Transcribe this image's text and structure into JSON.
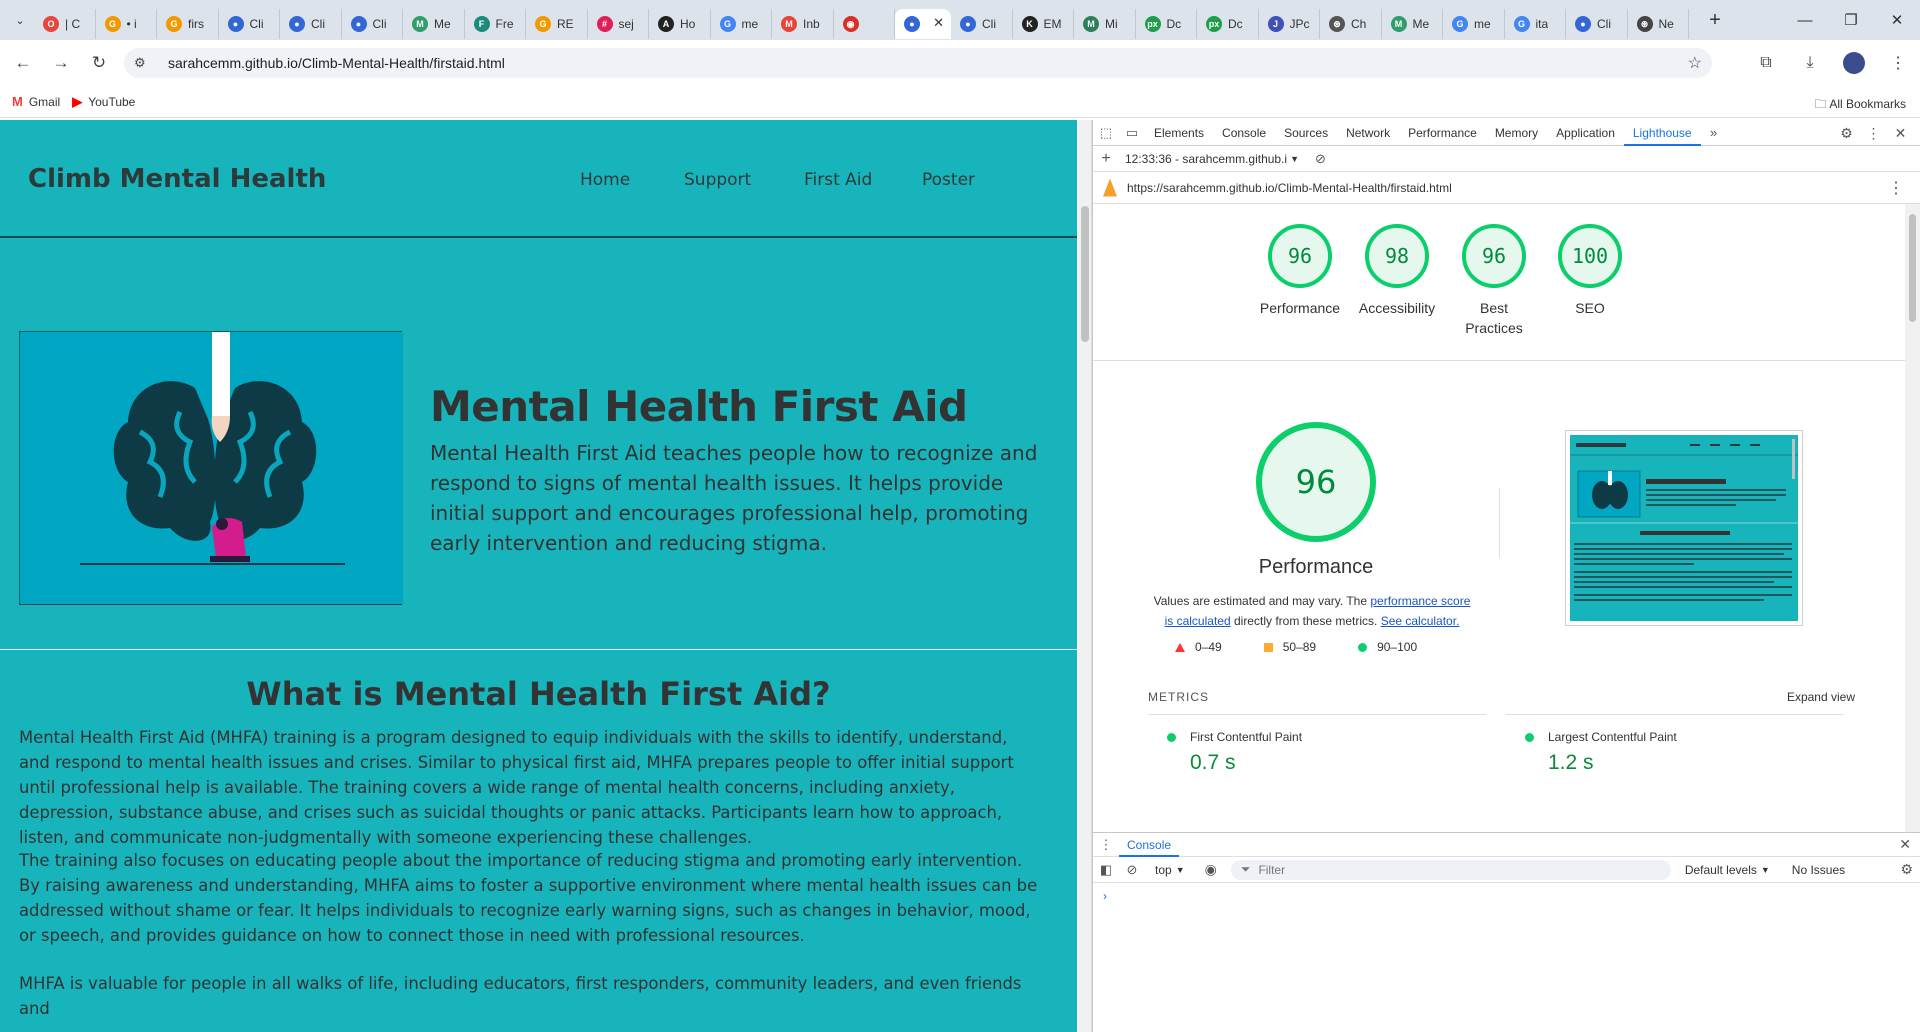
{
  "browser": {
    "tabs": [
      {
        "title": "| C",
        "color": "#e8453c",
        "glyph": "O"
      },
      {
        "title": "• i",
        "color": "#f29900",
        "glyph": "G"
      },
      {
        "title": "firs",
        "color": "#f29900",
        "glyph": "G"
      },
      {
        "title": "Cli",
        "color": "#3367d6",
        "glyph": "●"
      },
      {
        "title": "Cli",
        "color": "#3367d6",
        "glyph": "●"
      },
      {
        "title": "Cli",
        "color": "#3367d6",
        "glyph": "●"
      },
      {
        "title": "Me",
        "color": "#2e9e6b",
        "glyph": "M"
      },
      {
        "title": "Fre",
        "color": "#1a8a7a",
        "glyph": "F"
      },
      {
        "title": "RE",
        "color": "#f29900",
        "glyph": "G"
      },
      {
        "title": "sej",
        "color": "#e01e5a",
        "glyph": "#"
      },
      {
        "title": "Ho",
        "color": "#222222",
        "glyph": "A"
      },
      {
        "title": "me",
        "color": "#4285f4",
        "glyph": "G"
      },
      {
        "title": "Inb",
        "color": "#ea4335",
        "glyph": "M"
      },
      {
        "title": "",
        "color": "#d93025",
        "glyph": "◉"
      },
      {
        "title": "",
        "color": "#3367d6",
        "glyph": "●",
        "active": true
      },
      {
        "title": "Cli",
        "color": "#3367d6",
        "glyph": "●"
      },
      {
        "title": "EM",
        "color": "#222222",
        "glyph": "K"
      },
      {
        "title": "Mi",
        "color": "#2e7d5b",
        "glyph": "M"
      },
      {
        "title": "Dc",
        "color": "#1e9e48",
        "glyph": "px"
      },
      {
        "title": "Dc",
        "color": "#1e9e48",
        "glyph": "px"
      },
      {
        "title": "JPc",
        "color": "#3f51b5",
        "glyph": "J"
      },
      {
        "title": "Ch",
        "color": "#555555",
        "glyph": "⊛"
      },
      {
        "title": "Me",
        "color": "#2e9e6b",
        "glyph": "M"
      },
      {
        "title": "me",
        "color": "#4285f4",
        "glyph": "G"
      },
      {
        "title": "ita",
        "color": "#4285f4",
        "glyph": "G"
      },
      {
        "title": "Cli",
        "color": "#3367d6",
        "glyph": "●"
      },
      {
        "title": "Ne",
        "color": "#444444",
        "glyph": "⊛"
      }
    ],
    "url": "sarahcemm.github.io/Climb-Mental-Health/firstaid.html",
    "bookmarks": [
      {
        "label": "Gmail",
        "icon": "gmail-icon",
        "glyph": "M",
        "color": "#ea4335"
      },
      {
        "label": "YouTube",
        "icon": "youtube-icon",
        "glyph": "▶",
        "color": "#ff0000"
      }
    ],
    "all_bookmarks": "All Bookmarks"
  },
  "site": {
    "title": "Climb Mental Health",
    "nav": [
      "Home",
      "Support",
      "First Aid",
      "Poster"
    ],
    "hero_title": "Mental Health First Aid",
    "hero_text": "Mental Health First Aid teaches people how to recognize and respond to signs of mental health issues. It helps provide initial support and encourages professional help, promoting early intervention and reducing stigma.",
    "section_title": "What is Mental Health First Aid?",
    "paragraphs": [
      "Mental Health First Aid (MHFA) training is a program designed to equip individuals with the skills to identify, understand, and respond to mental health issues and crises. Similar to physical first aid, MHFA prepares people to offer initial support until professional help is available. The training covers a wide range of mental health concerns, including anxiety, depression, substance abuse, and crises such as suicidal thoughts or panic attacks. Participants learn how to approach, listen, and communicate non-judgmentally with someone experiencing these challenges.",
      "The training also focuses on educating people about the importance of reducing stigma and promoting early intervention. By raising awareness and understanding, MHFA aims to foster a supportive environment where mental health issues can be addressed without shame or fear. It helps individuals to recognize early warning signs, such as changes in behavior, mood, or speech, and provides guidance on how to connect those in need with professional resources.",
      "MHFA is valuable for people in all walks of life, including educators, first responders, community leaders, and even friends and"
    ]
  },
  "devtools": {
    "tabs": [
      "Elements",
      "Console",
      "Sources",
      "Network",
      "Performance",
      "Memory",
      "Application",
      "Lighthouse"
    ],
    "active_tab": "Lighthouse",
    "report_select": "12:33:36 - sarahcemm.github.i",
    "report_url": "https://sarahcemm.github.io/Climb-Mental-Health/firstaid.html",
    "scores": [
      {
        "label": "Performance",
        "score": 96
      },
      {
        "label": "Accessibility",
        "score": 98
      },
      {
        "label": "Best Practices",
        "score": 96
      },
      {
        "label": "SEO",
        "score": 100
      }
    ],
    "perf_score": "96",
    "perf_label": "Performance",
    "perf_note_1": "Values are estimated and may vary. The ",
    "perf_note_link1": "performance score is calculated",
    "perf_note_2": " directly from these metrics. ",
    "perf_note_link2": "See calculator.",
    "legend": [
      "0–49",
      "50–89",
      "90–100"
    ],
    "metrics_heading": "METRICS",
    "expand_view": "Expand view",
    "metrics": [
      {
        "name": "First Contentful Paint",
        "value": "0.7 s"
      },
      {
        "name": "Largest Contentful Paint",
        "value": "1.2 s"
      }
    ],
    "colors": {
      "pass": "#0cce6b",
      "average": "#ffaa33",
      "fail": "#ff3333",
      "accent": "#1a73e8"
    },
    "console": {
      "tab": "Console",
      "context": "top",
      "filter_placeholder": "Filter",
      "levels": "Default levels",
      "issues": "No Issues"
    }
  }
}
